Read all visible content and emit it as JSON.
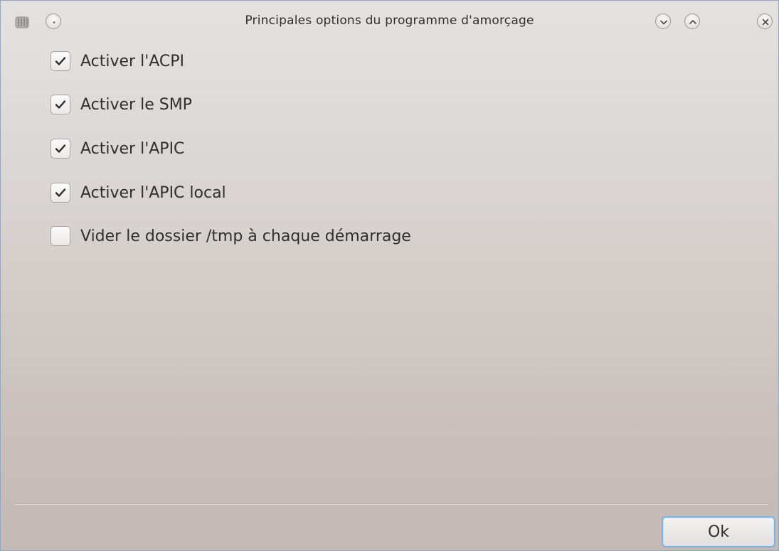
{
  "window": {
    "title": "Principales options du programme d'amorçage"
  },
  "titlebar": {
    "icons": [
      "drive-icon",
      "menu-dot-icon"
    ],
    "buttons": [
      "minimize-button",
      "maximize-button",
      "close-button"
    ]
  },
  "options": [
    {
      "label": "Activer l'ACPI",
      "checked": true
    },
    {
      "label": "Activer le SMP",
      "checked": true
    },
    {
      "label": "Activer l'APIC",
      "checked": true
    },
    {
      "label": "Activer l'APIC local",
      "checked": true
    },
    {
      "label": "Vider le dossier /tmp à chaque démarrage",
      "checked": false
    }
  ],
  "footer": {
    "ok_label": "Ok"
  },
  "colors": {
    "focus_border": "#7fb1e0",
    "window_border": "#8fa8bf"
  }
}
